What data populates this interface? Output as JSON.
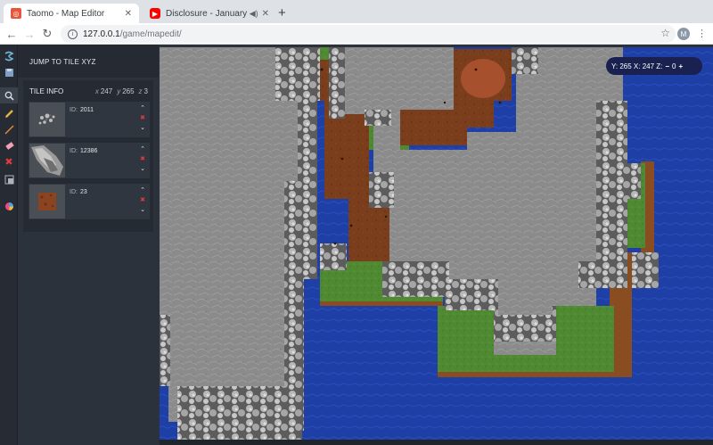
{
  "browser": {
    "tabs": [
      {
        "title": "Taomo - Map Editor",
        "favicon": "taomo-logo-icon",
        "close": "✕"
      },
      {
        "title": "Disclosure - January - You",
        "favicon": "youtube-icon",
        "close": "✕"
      }
    ],
    "new_tab": "+",
    "url_host": "127.0.0.1",
    "url_path": "/game/mapedit/",
    "profile_initial": "M"
  },
  "sidebar_tools": [
    {
      "icon": "taomo-swirl-icon"
    },
    {
      "icon": "save-icon"
    },
    {
      "icon": "zoom-search-icon"
    },
    {
      "icon": "pencil-icon"
    },
    {
      "icon": "line-icon"
    },
    {
      "icon": "eraser-icon"
    },
    {
      "icon": "delete-x-icon"
    },
    {
      "icon": "layer-icon"
    },
    {
      "icon": "palette-icon"
    }
  ],
  "panel": {
    "jump_label": "JUMP TO TILE XYZ",
    "tile_info_label": "TILE INFO",
    "coords": {
      "x_label": "x",
      "x": "247",
      "y_label": "y",
      "y": "265",
      "z_label": "z",
      "z": "3"
    },
    "id_label": "ID:",
    "tiles": [
      {
        "id": "2011"
      },
      {
        "id": "12386"
      },
      {
        "id": "23"
      }
    ],
    "controls": {
      "up": "⌃",
      "remove": "✖",
      "down": "⌄"
    }
  },
  "map_overlay": {
    "text": "Y: 265 X: 247  Z:",
    "minus": "−",
    "zoom": "0",
    "plus": "+"
  },
  "colors": {
    "water": "#1e3fa6",
    "rock": "#8a8a8a",
    "dirt": "#7a3e1c",
    "grass": "#4f8a33",
    "panel": "#2c323b",
    "accent_red": "#e0393e"
  }
}
